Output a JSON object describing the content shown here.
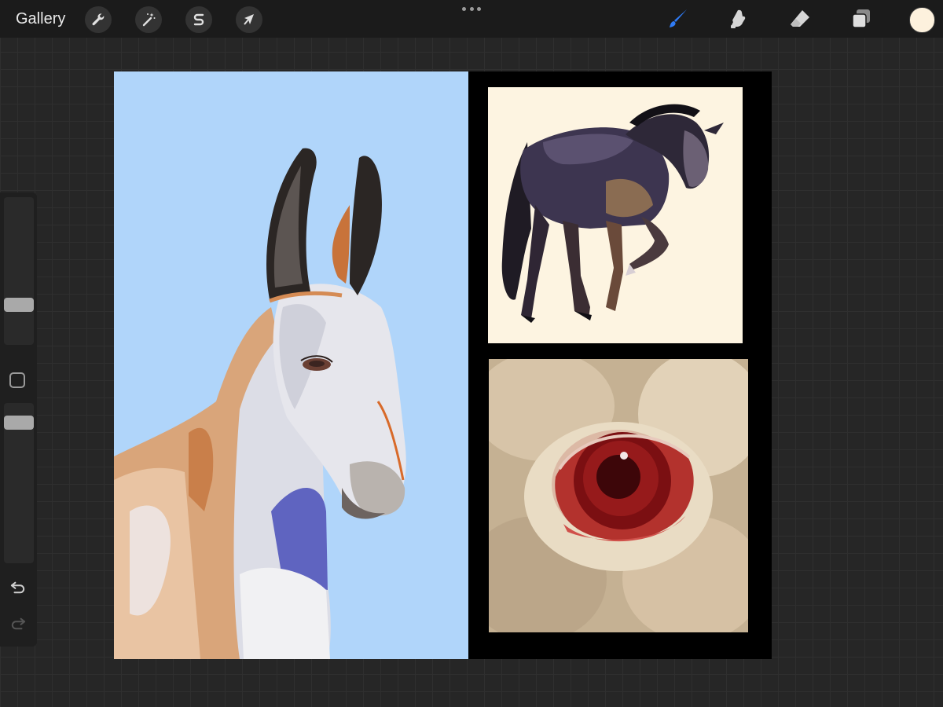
{
  "topbar": {
    "gallery_label": "Gallery",
    "left_tools": [
      {
        "name": "actions",
        "icon": "wrench-icon"
      },
      {
        "name": "adjustments",
        "icon": "magic-wand-icon"
      },
      {
        "name": "selection",
        "icon": "selection-s-icon"
      },
      {
        "name": "transform",
        "icon": "arrow-cursor-icon"
      }
    ],
    "right_tools": [
      {
        "name": "brush",
        "icon": "brush-icon",
        "active": true
      },
      {
        "name": "smudge",
        "icon": "smudge-icon"
      },
      {
        "name": "eraser",
        "icon": "eraser-icon"
      },
      {
        "name": "layers",
        "icon": "layers-icon"
      }
    ],
    "current_color": "#fdf1dd",
    "accent_color": "#2f7bf5"
  },
  "sidebar": {
    "brush_size_level": 0.27,
    "opacity_level": 0.58,
    "icons": [
      "modify-square-icon",
      "undo-icon",
      "redo-icon"
    ]
  },
  "canvas": {
    "panels": [
      {
        "name": "donkey-painting",
        "background": "#b0d5fa"
      },
      {
        "name": "horse-painting",
        "background": "#fdf4e1"
      },
      {
        "name": "eye-painting",
        "background": "#c5b193"
      }
    ]
  }
}
